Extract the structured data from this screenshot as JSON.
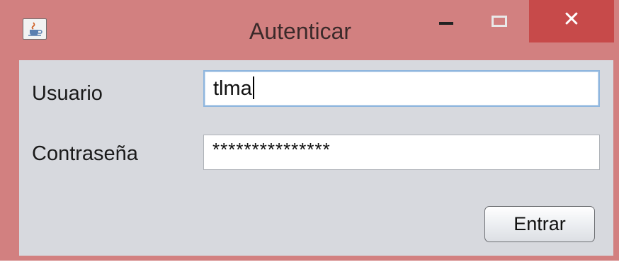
{
  "window": {
    "title": "Autenticar",
    "app_icon": "java-cup-icon",
    "controls": {
      "minimize": "minimize-icon",
      "maximize": "maximize-icon",
      "close_label": "✕"
    },
    "frame_color": "#d28080",
    "close_color": "#c74a4a"
  },
  "form": {
    "user_label": "Usuario",
    "user_value": "tlma",
    "password_label": "Contraseña",
    "password_value": "***************",
    "submit_label": "Entrar"
  }
}
